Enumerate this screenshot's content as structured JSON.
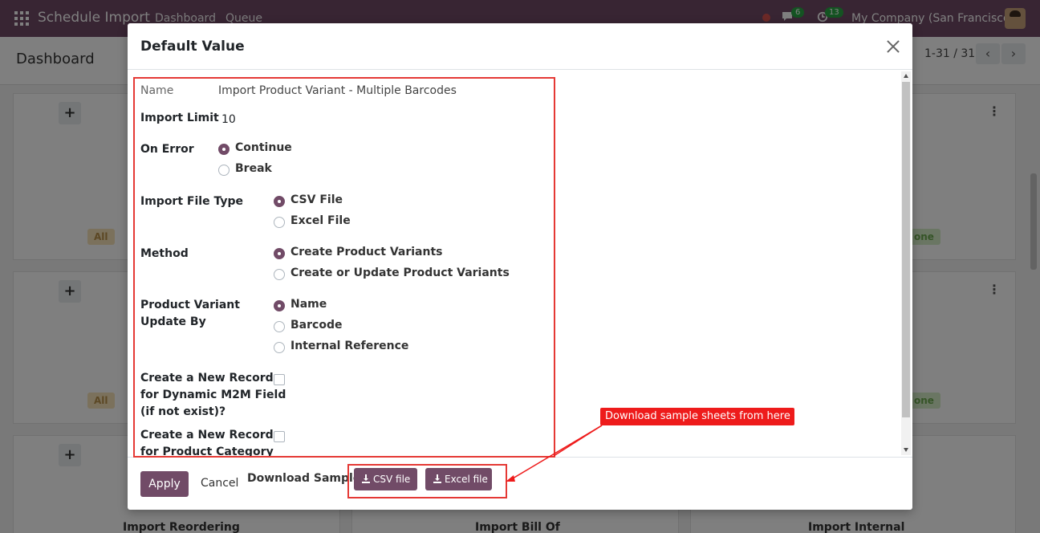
{
  "topbar": {
    "app_title": "Schedule Import",
    "menu_dashboard": "Dashboard",
    "menu_queue": "Queue",
    "messages_count": "6",
    "activities_count": "13",
    "company": "My Company (San Francisco)"
  },
  "controlbar": {
    "breadcrumb": "Dashboard",
    "pager": "1-31 / 31"
  },
  "background": {
    "pill_all": "All",
    "pill_done": "one",
    "card_title_1": "Import Reordering",
    "card_title_2": "Import Bill Of",
    "card_title_3": "Import Internal"
  },
  "modal": {
    "title": "Default Value",
    "fields": {
      "name_label": "Name",
      "name_value": "Import Product Variant - Multiple Barcodes",
      "import_limit_label": "Import Limit",
      "import_limit_value": "10",
      "on_error_label": "On Error",
      "on_error_options": [
        "Continue",
        "Break"
      ],
      "file_type_label": "Import File Type",
      "file_type_options": [
        "CSV File",
        "Excel File"
      ],
      "method_label": "Method",
      "method_options": [
        "Create Product Variants",
        "Create or Update Product Variants"
      ],
      "update_by_label_1": "Product Variant",
      "update_by_label_2": "Update By",
      "update_by_options": [
        "Name",
        "Barcode",
        "Internal Reference"
      ],
      "m2m_label_1": "Create a New Record",
      "m2m_label_2": "for Dynamic M2M Field",
      "m2m_label_3": "(if not exist)?",
      "category_label_1": "Create a New Record",
      "category_label_2": "for Product Category"
    },
    "footer": {
      "apply": "Apply",
      "cancel": "Cancel",
      "download_label": "Download Sample:",
      "csv_button": "CSV file",
      "excel_button": "Excel file"
    }
  },
  "annotation": {
    "callout": "Download sample sheets from here"
  },
  "colors": {
    "primary": "#714b67",
    "annotation_red": "#e53935"
  }
}
